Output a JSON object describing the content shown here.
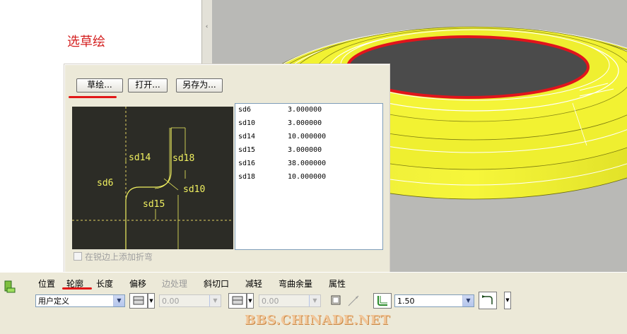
{
  "annotation": {
    "text": "选草绘"
  },
  "popup": {
    "buttons": {
      "sketch": "草绘...",
      "open": "打开...",
      "save_as": "另存为..."
    },
    "sketch_labels": {
      "sd6": "sd6",
      "sd14": "sd14",
      "sd18": "sd18",
      "sd10": "sd10",
      "sd15": "sd15"
    },
    "params": [
      {
        "name": "sd6",
        "value": "3.000000"
      },
      {
        "name": "sd10",
        "value": "3.000000"
      },
      {
        "name": "sd14",
        "value": "10.000000"
      },
      {
        "name": "sd15",
        "value": "3.000000"
      },
      {
        "name": "sd16",
        "value": "38.000000"
      },
      {
        "name": "sd18",
        "value": "10.000000"
      }
    ],
    "add_bend_checkbox": {
      "label": "在锐边上添加折弯",
      "checked": false,
      "enabled": false
    }
  },
  "dashboard": {
    "tabs": [
      {
        "label": "位置",
        "enabled": true
      },
      {
        "label": "轮廓",
        "enabled": true,
        "active": true
      },
      {
        "label": "长度",
        "enabled": true
      },
      {
        "label": "偏移",
        "enabled": true
      },
      {
        "label": "边处理",
        "enabled": false
      },
      {
        "label": "斜切口",
        "enabled": true
      },
      {
        "label": "减轻",
        "enabled": true
      },
      {
        "label": "弯曲余量",
        "enabled": true
      },
      {
        "label": "属性",
        "enabled": true
      }
    ],
    "profile_type": "用户定义",
    "value_1": "0.00",
    "value_2": "0.00",
    "thickness": "1.50"
  },
  "watermark": "BBS.CHINADE.NET",
  "colors": {
    "highlight_red": "#e11717",
    "model_yellow": "#f0f020",
    "sketch_bg": "#2c2c26",
    "sketch_line": "#f0f060"
  }
}
